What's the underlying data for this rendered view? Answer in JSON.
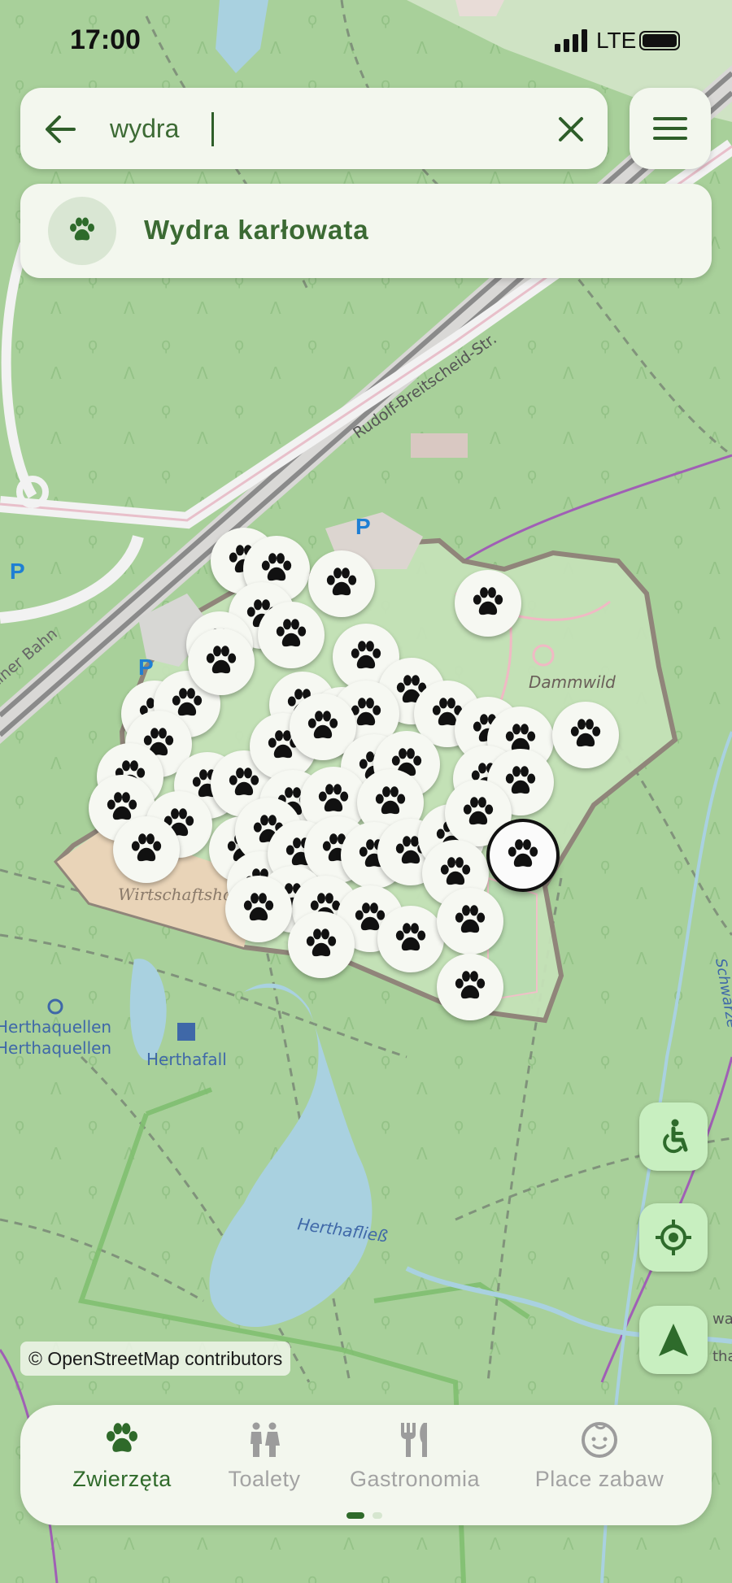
{
  "status_bar": {
    "time": "17:00",
    "network": "LTE"
  },
  "search": {
    "value": "wydra",
    "placeholder": ""
  },
  "results": [
    {
      "label": "Wydra karłowata",
      "icon": "paw-icon"
    }
  ],
  "map": {
    "labels": {
      "street": "Rudolf-Breitscheid-Str.",
      "railway": "ttiner Bahn",
      "enclosure": "Dammwild",
      "farm": "Wirtschaftshof",
      "spring1": "Herthaquellen",
      "spring2": "Herthaquellen",
      "waterfall": "Herthafall",
      "stream1": "Herthafließ",
      "stream2": "Schwarze",
      "parking": "P",
      "edge1": "walc",
      "edge2": "tha"
    },
    "attribution": "© OpenStreetMap contributors"
  },
  "fabs": [
    {
      "name": "accessibility",
      "icon": "wheelchair-icon"
    },
    {
      "name": "locate",
      "icon": "crosshair-icon"
    },
    {
      "name": "navigate",
      "icon": "navigation-arrow-icon"
    }
  ],
  "bottom_nav": {
    "items": [
      {
        "label": "Zwierzęta",
        "icon": "paw-icon",
        "active": true
      },
      {
        "label": "Toalety",
        "icon": "toilet-icon",
        "active": false
      },
      {
        "label": "Gastronomia",
        "icon": "cutlery-icon",
        "active": false
      },
      {
        "label": "Place zabaw",
        "icon": "child-face-icon",
        "active": false
      }
    ],
    "page_indicator": {
      "pages": 2,
      "current": 1
    }
  },
  "colors": {
    "accent": "#2f6a2a",
    "map_green": "#a8d09a",
    "water": "#a9d1e0",
    "zoo_boundary": "#8f8279",
    "farm_area": "#e9d4b8",
    "fab_bg": "#c8efc0",
    "panel_bg": "#f3f7ee"
  }
}
